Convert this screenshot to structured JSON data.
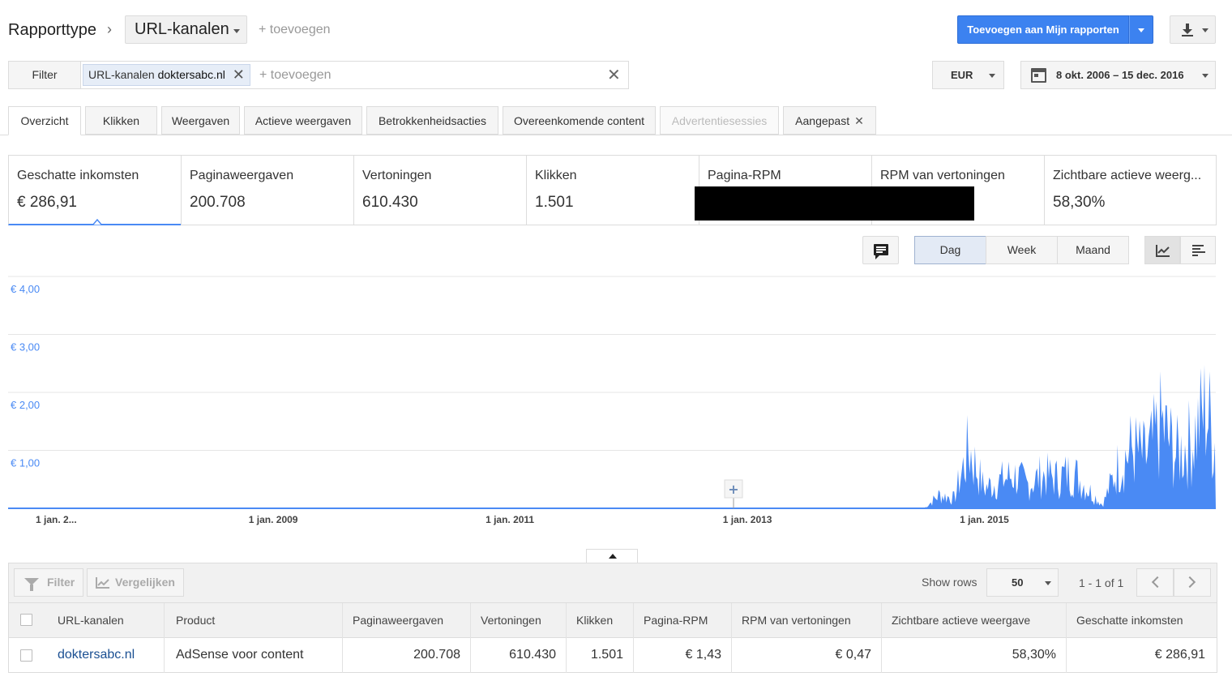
{
  "header": {
    "breadcrumb_label": "Rapporttype",
    "report_type_value": "URL-kanalen",
    "report_add": "+ toevoegen",
    "add_to_reports_label": "Toevoegen aan Mijn rapporten"
  },
  "filter": {
    "button_label": "Filter",
    "chip_prefix": "URL-kanalen",
    "chip_value": "doktersabc.nl",
    "add_placeholder": "+ toevoegen",
    "currency": "EUR",
    "date_range": "8 okt. 2006 – 15 dec. 2016"
  },
  "tabs": [
    {
      "label": "Overzicht",
      "active": true
    },
    {
      "label": "Klikken"
    },
    {
      "label": "Weergaven"
    },
    {
      "label": "Actieve weergaven"
    },
    {
      "label": "Betrokkenheidsacties"
    },
    {
      "label": "Overeenkomende content"
    },
    {
      "label": "Advertentiesessies",
      "disabled": true
    },
    {
      "label": "Aangepast"
    }
  ],
  "scorecards": [
    {
      "label": "Geschatte inkomsten",
      "value": "€ 286,91"
    },
    {
      "label": "Paginaweergaven",
      "value": "200.708"
    },
    {
      "label": "Vertoningen",
      "value": "610.430"
    },
    {
      "label": "Klikken",
      "value": "1.501"
    },
    {
      "label": "Pagina-RPM",
      "value": ""
    },
    {
      "label": "RPM van vertoningen",
      "value": ""
    },
    {
      "label": "Zichtbare actieve weerg...",
      "value": "58,30%"
    }
  ],
  "granularity": {
    "day": "Dag",
    "week": "Week",
    "month": "Maand",
    "selected": "Dag"
  },
  "chart_data": {
    "type": "line",
    "ylim": [
      0,
      4
    ],
    "y_ticks": [
      "€ 4,00",
      "€ 3,00",
      "€ 2,00",
      "€ 1,00"
    ],
    "x_ticks": [
      "1 jan. 2...",
      "1 jan. 2009",
      "1 jan. 2011",
      "1 jan. 2013",
      "1 jan. 2015"
    ],
    "x_range": [
      "2006-10-08",
      "2016-12-15"
    ],
    "color": "#4a8af4",
    "series": [
      {
        "x": [
          "2006-10-08",
          "2014-07-01",
          "2014-08-15",
          "2014-10-01",
          "2014-11-15",
          "2015-01-01",
          "2015-02-15",
          "2015-04-01",
          "2015-05-15",
          "2015-07-01",
          "2015-08-15",
          "2015-10-01",
          "2015-11-15",
          "2016-01-01",
          "2016-02-15",
          "2016-04-01",
          "2016-05-15",
          "2016-07-01",
          "2016-08-15",
          "2016-10-01",
          "2016-11-15",
          "2016-12-15"
        ],
        "y": [
          0,
          0,
          0.4,
          0.3,
          1.8,
          0.6,
          0.8,
          1.0,
          0.7,
          1.0,
          0.9,
          1.1,
          0.6,
          0.1,
          1.2,
          1.8,
          1.5,
          2.5,
          1.6,
          2.0,
          3.0,
          1.9
        ]
      }
    ]
  },
  "table": {
    "toolbar": {
      "filter": "Filter",
      "compare": "Vergelijken",
      "show_rows": "Show rows",
      "rows": "50",
      "pager": "1 - 1 of 1"
    },
    "columns": [
      "URL-kanalen",
      "Product",
      "Paginaweergaven",
      "Vertoningen",
      "Klikken",
      "Pagina-RPM",
      "RPM van vertoningen",
      "Zichtbare actieve weergave",
      "Geschatte inkomsten"
    ],
    "rows": [
      [
        "doktersabc.nl",
        "AdSense voor content",
        "200.708",
        "610.430",
        "1.501",
        "€ 1,43",
        "€ 0,47",
        "58,30%",
        "€ 286,91"
      ]
    ]
  }
}
